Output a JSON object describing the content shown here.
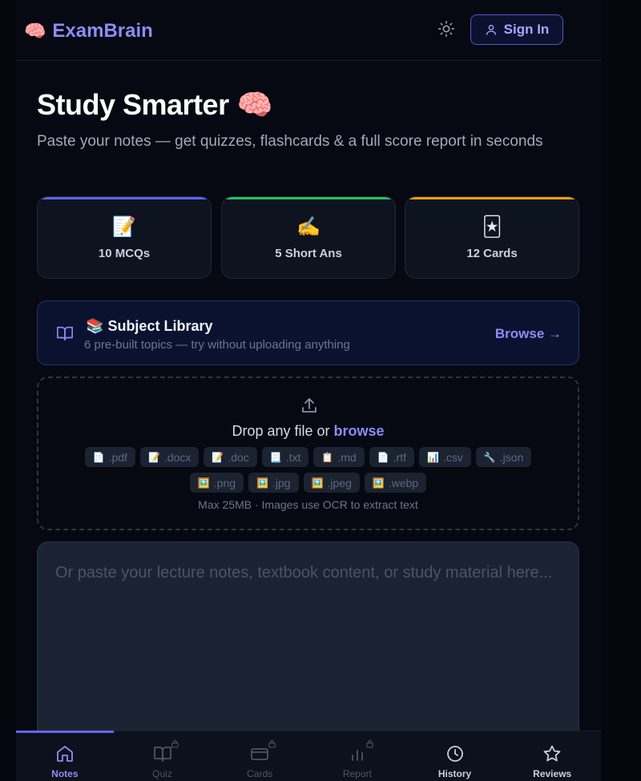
{
  "header": {
    "brand_emoji": "🧠",
    "brand_name": "ExamBrain",
    "theme_icon": "sun-icon",
    "signin_label": "Sign In"
  },
  "hero": {
    "title": "Study Smarter",
    "title_emoji": "🧠",
    "subtitle": "Paste your notes — get quizzes, flashcards & a full score report in seconds"
  },
  "stats": [
    {
      "emoji": "📝",
      "label": "10 MCQs",
      "accent": "#5b63f0"
    },
    {
      "emoji": "✍️",
      "label": "5 Short Ans",
      "accent": "#22c55e"
    },
    {
      "emoji": "🃏",
      "label": "12 Cards",
      "accent": "#f59e0b"
    }
  ],
  "library": {
    "emoji": "📚",
    "title": "Subject Library",
    "description": "6 pre-built topics — try without uploading anything",
    "browse_label": "Browse →"
  },
  "dropzone": {
    "text": "Drop any file or ",
    "link": "browse",
    "chips_row1": [
      {
        "emoji": "📄",
        "label": ".pdf"
      },
      {
        "emoji": "📝",
        "label": ".docx"
      },
      {
        "emoji": "📝",
        "label": ".doc"
      },
      {
        "emoji": "📃",
        "label": ".txt"
      },
      {
        "emoji": "📋",
        "label": ".md"
      },
      {
        "emoji": "📄",
        "label": ".rtf"
      },
      {
        "emoji": "📊",
        "label": ".csv"
      },
      {
        "emoji": "🔧",
        "label": ".json"
      }
    ],
    "chips_row2": [
      {
        "emoji": "🖼️",
        "label": ".png"
      },
      {
        "emoji": "🖼️",
        "label": ".jpg"
      },
      {
        "emoji": "🖼️",
        "label": ".jpeg"
      },
      {
        "emoji": "🖼️",
        "label": ".webp"
      }
    ],
    "note": "Max 25MB · Images use OCR to extract text"
  },
  "notes": {
    "placeholder": "Or paste your lecture notes, textbook content, or study material here..."
  },
  "nav": [
    {
      "label": "Notes",
      "icon": "home-icon",
      "state": "active",
      "locked": false
    },
    {
      "label": "Quiz",
      "icon": "book-icon",
      "state": "disabled",
      "locked": true
    },
    {
      "label": "Cards",
      "icon": "card-icon",
      "state": "disabled",
      "locked": true
    },
    {
      "label": "Report",
      "icon": "bar-chart-icon",
      "state": "disabled",
      "locked": true
    },
    {
      "label": "History",
      "icon": "clock-icon",
      "state": "bright",
      "locked": false
    },
    {
      "label": "Reviews",
      "icon": "star-icon",
      "state": "bright",
      "locked": false
    }
  ],
  "colors": {
    "accent": "#8b8cf6",
    "background": "#05070f"
  }
}
